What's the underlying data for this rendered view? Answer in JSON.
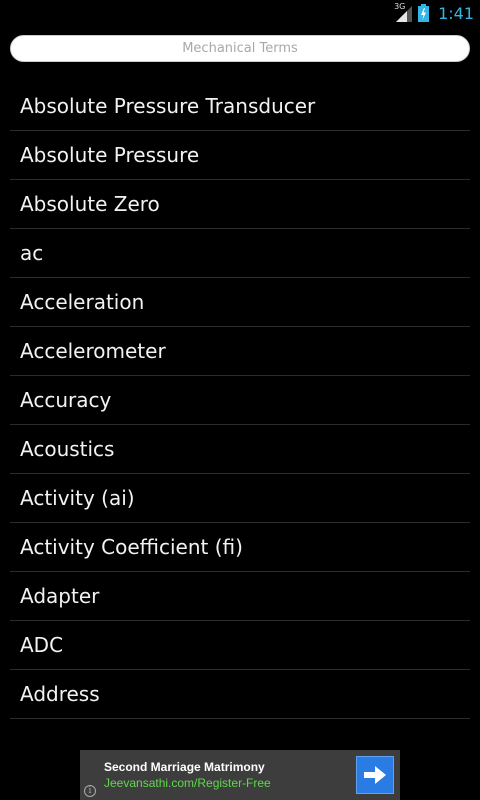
{
  "status_bar": {
    "network_type": "3G",
    "time": "1:41",
    "time_color": "#33b5e5"
  },
  "search": {
    "label": "Mechanical Terms"
  },
  "terms": [
    "Absolute Pressure Transducer",
    "Absolute Pressure",
    "Absolute Zero",
    "ac",
    "Acceleration",
    "Accelerometer",
    "Accuracy",
    "Acoustics",
    "Activity (ai)",
    "Activity Coefficient (fi)",
    "Adapter",
    "ADC",
    "Address"
  ],
  "ad": {
    "title": "Second Marriage Matrimony",
    "url": "Jeevansathi.com/Register-Free",
    "info_glyph": "i",
    "url_color": "#5fd84c",
    "button_color": "#2a7be4"
  }
}
